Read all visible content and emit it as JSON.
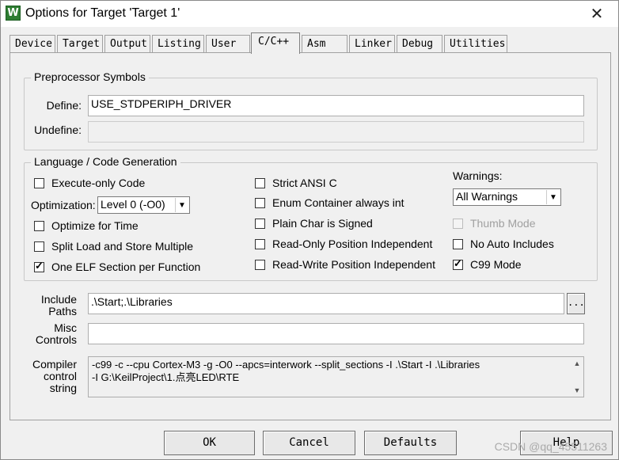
{
  "window": {
    "title": "Options for Target 'Target 1'",
    "app_icon": "W",
    "close": "✕"
  },
  "tabs": [
    {
      "label": "Device"
    },
    {
      "label": "Target"
    },
    {
      "label": "Output"
    },
    {
      "label": "Listing"
    },
    {
      "label": "User"
    },
    {
      "label": "C/C++"
    },
    {
      "label": "Asm"
    },
    {
      "label": "Linker"
    },
    {
      "label": "Debug"
    },
    {
      "label": "Utilities"
    }
  ],
  "preprocessor": {
    "title": "Preprocessor Symbols",
    "define_label": "Define:",
    "define_value": "USE_STDPERIPH_DRIVER",
    "undefine_label": "Undefine:",
    "undefine_value": ""
  },
  "language": {
    "title": "Language / Code Generation",
    "execute_only": "Execute-only Code",
    "optimization_label": "Optimization:",
    "optimization_value": "Level 0 (-O0)",
    "optimize_time": "Optimize for Time",
    "split_load": "Split Load and Store Multiple",
    "one_elf": "One ELF Section per Function",
    "strict_ansi": "Strict ANSI C",
    "enum_container": "Enum Container always int",
    "plain_char": "Plain Char is Signed",
    "ro_pi": "Read-Only Position Independent",
    "rw_pi": "Read-Write Position Independent",
    "warnings_label": "Warnings:",
    "warnings_value": "All Warnings",
    "thumb_mode": "Thumb Mode",
    "no_auto": "No Auto Includes",
    "c99": "C99 Mode"
  },
  "include": {
    "label1": "Include",
    "label2": "Paths",
    "value": ".\\Start;.\\Libraries",
    "browse": "..."
  },
  "misc": {
    "label1": "Misc",
    "label2": "Controls",
    "value": ""
  },
  "compiler": {
    "label1": "Compiler",
    "label2": "control",
    "label3": "string",
    "line1": "-c99 -c --cpu Cortex-M3 -g -O0 --apcs=interwork --split_sections -I .\\Start -I .\\Libraries",
    "line2": "-I G:\\KeilProject\\1.点亮LED\\RTE"
  },
  "buttons": {
    "ok": "OK",
    "cancel": "Cancel",
    "defaults": "Defaults",
    "help": "Help"
  },
  "watermark": "CSDN @qq_45511263"
}
